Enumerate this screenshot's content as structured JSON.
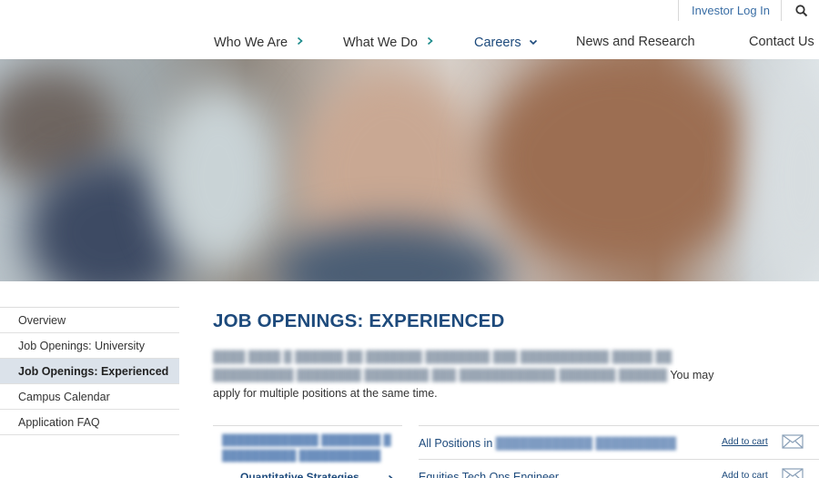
{
  "utility": {
    "investor_login": "Investor Log In",
    "search_icon": "search-icon"
  },
  "nav": {
    "items": [
      {
        "label": "Who We Are",
        "icon": "chevron-right-icon"
      },
      {
        "label": "What We Do",
        "icon": "chevron-right-icon"
      },
      {
        "label": "Careers",
        "icon": "chevron-down-icon",
        "active": true
      },
      {
        "label": "News and Research"
      },
      {
        "label": "Contact Us"
      }
    ],
    "accent_color": "#1d4a7c",
    "chevron_color": "#1a8a8a"
  },
  "sidebar": {
    "items": [
      {
        "label": "Overview"
      },
      {
        "label": "Job Openings: University"
      },
      {
        "label": "Job Openings: Experienced",
        "active": true
      },
      {
        "label": "Campus Calendar"
      },
      {
        "label": "Application FAQ"
      }
    ],
    "active_bg": "#dbe2ea"
  },
  "main": {
    "title": "JOB OPENINGS: EXPERIENCED",
    "intro_visible": "You may apply for multiple positions at the same time.",
    "category": {
      "subcategory": "Quantitative Strategies"
    },
    "positions": [
      {
        "title_prefix": "All Positions in",
        "cart": "Add to cart"
      },
      {
        "title": "Equities Tech Ops Engineer",
        "cart": "Add to cart"
      }
    ]
  }
}
